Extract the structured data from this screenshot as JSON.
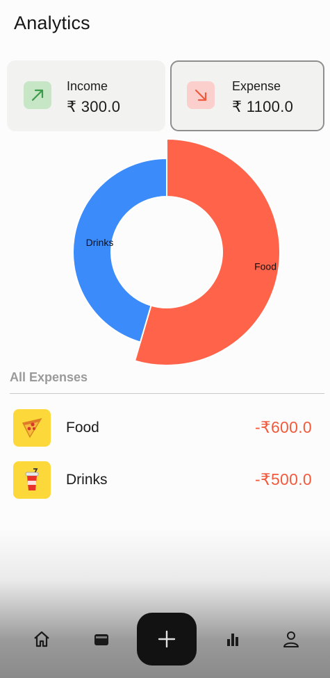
{
  "header": {
    "title": "Analytics"
  },
  "summary": {
    "income": {
      "label": "Income",
      "value": "₹ 300.0",
      "icon": "arrow-up-right-icon",
      "color": "#3c9a4a"
    },
    "expense": {
      "label": "Expense",
      "value": "₹ 1100.0",
      "icon": "arrow-down-right-icon",
      "color": "#ef5a3f"
    }
  },
  "chart_data": {
    "type": "pie",
    "donut": true,
    "categories": [
      "Food",
      "Drinks"
    ],
    "values": [
      600,
      500
    ],
    "colors": [
      "#ff634a",
      "#3b8bfb"
    ],
    "labels": [
      "Food",
      "Drinks"
    ]
  },
  "expenses": {
    "title": "All Expenses",
    "items": [
      {
        "name": "Food",
        "amount": "-₹600.0",
        "icon": "pizza-icon"
      },
      {
        "name": "Drinks",
        "amount": "-₹500.0",
        "icon": "drink-cup-icon"
      }
    ]
  },
  "nav": {
    "items": [
      "home-icon",
      "wallet-icon",
      "add-icon",
      "bar-chart-icon",
      "profile-icon"
    ]
  }
}
